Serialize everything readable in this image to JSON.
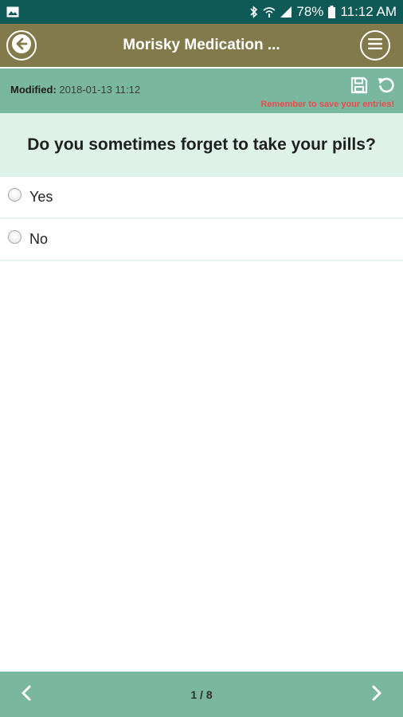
{
  "status_bar": {
    "battery": "78%",
    "time": "11:12 AM",
    "icons": [
      "image-icon",
      "bluetooth-icon",
      "wifi-icon",
      "signal-icon",
      "battery-icon"
    ]
  },
  "header": {
    "title": "Morisky Medication ...",
    "back_icon": "arrow-left-icon",
    "menu_icon": "hamburger-menu-icon"
  },
  "info": {
    "modified_label": "Modified",
    "modified_value": "2018-01-13 11:12",
    "reminder": "Remember to save your entries!",
    "save_icon": "floppy-disk-icon",
    "reset_icon": "undo-icon"
  },
  "question": {
    "text": "Do you sometimes forget to take your pills?"
  },
  "answers": [
    {
      "label": "Yes",
      "selected": false
    },
    {
      "label": "No",
      "selected": false
    }
  ],
  "footer": {
    "page_indicator": "1 / 8",
    "prev_icon": "chevron-left-icon",
    "next_icon": "chevron-right-icon"
  },
  "colors": {
    "status_bar": "#0e5a57",
    "header": "#827a4b",
    "accent": "#7ab79f",
    "question_bg": "#dff2ea",
    "reminder": "#e84c4c"
  }
}
